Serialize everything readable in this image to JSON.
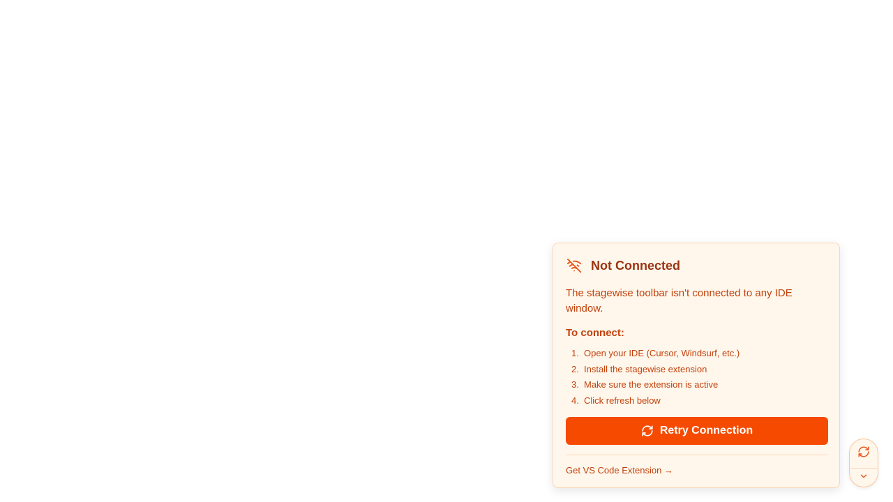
{
  "panel": {
    "title": "Not Connected",
    "title_icon": "wifi-off-icon",
    "description": "The stagewise toolbar isn't connected to any IDE window.",
    "connect_heading": "To connect:",
    "steps": [
      {
        "num": "1.",
        "text": "Open your IDE (Cursor, Windsurf, etc.)"
      },
      {
        "num": "2.",
        "text": "Install the stagewise extension"
      },
      {
        "num": "3.",
        "text": "Make sure the extension is active"
      },
      {
        "num": "4.",
        "text": "Click refresh below"
      }
    ],
    "retry_label": "Retry Connection",
    "retry_icon": "refresh-icon",
    "extension_link": "Get VS Code Extension →"
  },
  "mini_toolbar": {
    "refresh_icon": "refresh-icon",
    "collapse_icon": "chevron-down-icon"
  },
  "colors": {
    "accent": "#f54a00",
    "panel_bg": "#fff7ec",
    "panel_border": "#fcd6b4",
    "text": "#c2410c",
    "title": "#9a3412"
  }
}
